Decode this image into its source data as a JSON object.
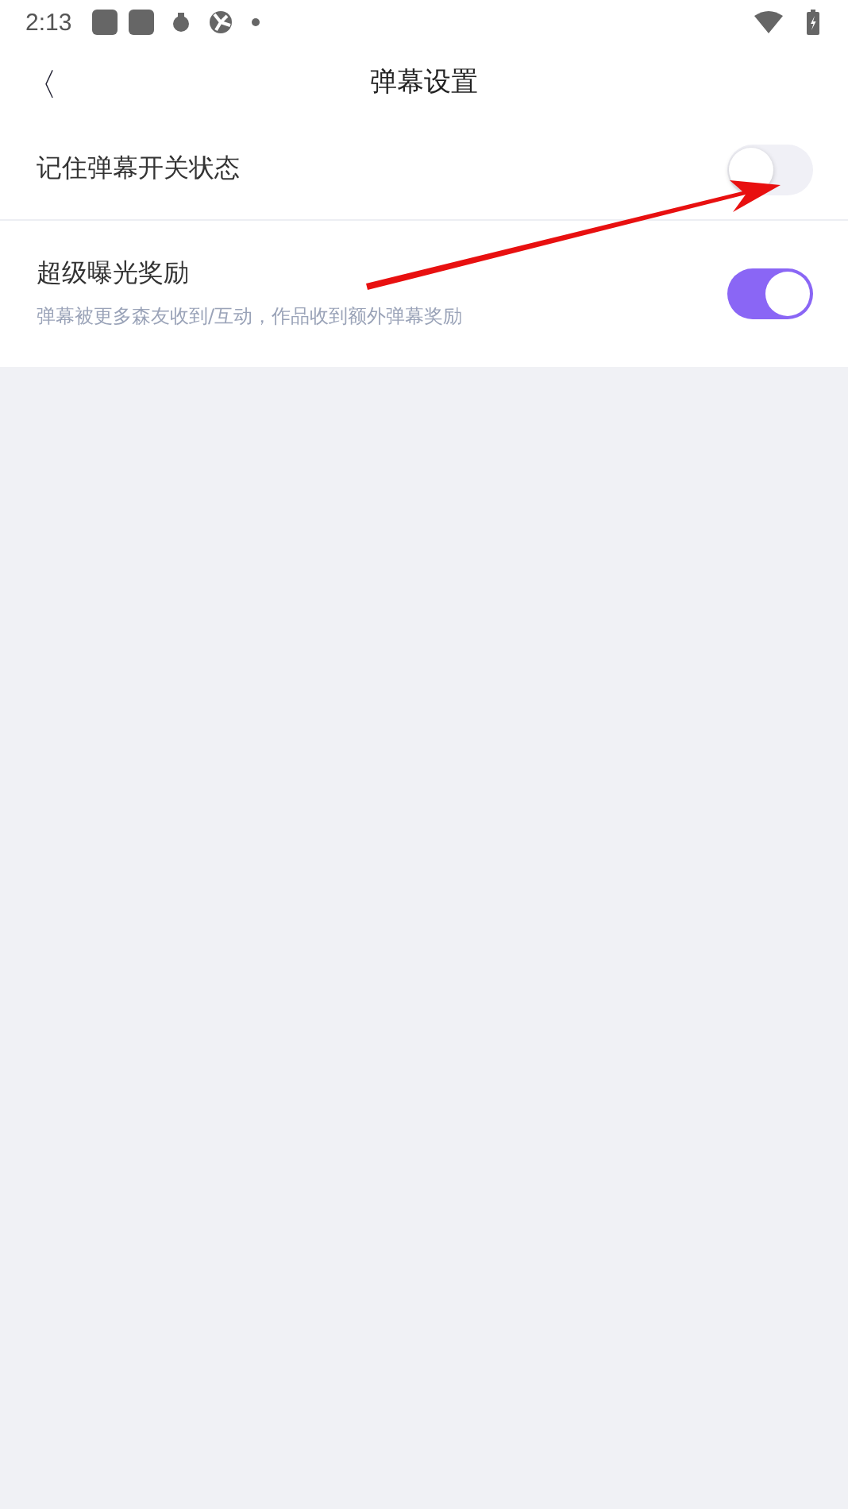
{
  "status_bar": {
    "time": "2:13"
  },
  "header": {
    "back": "〈",
    "title": "弹幕设置"
  },
  "settings": [
    {
      "label": "记住弹幕开关状态",
      "on": false
    },
    {
      "label": "超级曝光奖励",
      "description": "弹幕被更多森友收到/互动，作品收到额外弹幕奖励",
      "on": true
    }
  ]
}
